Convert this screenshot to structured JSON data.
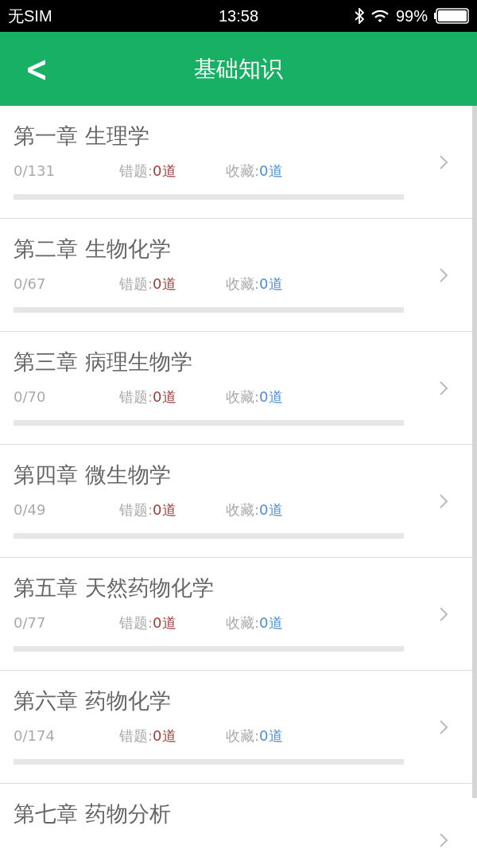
{
  "status_bar": {
    "carrier": "无SIM",
    "time": "13:58",
    "battery": "99%"
  },
  "header": {
    "back": "<",
    "title": "基础知识"
  },
  "chapters": [
    {
      "title": "第一章 生理学",
      "count": "0/131",
      "wrong_label": "错题:",
      "wrong_value": "0道",
      "fav_label": "收藏:",
      "fav_value": "0道",
      "level": 0
    },
    {
      "title": "第二章 生物化学",
      "count": "0/67",
      "wrong_label": "错题:",
      "wrong_value": "0道",
      "fav_label": "收藏:",
      "fav_value": "0道",
      "level": 0
    },
    {
      "title": "第三章 病理生物学",
      "count": "0/70",
      "wrong_label": "错题:",
      "wrong_value": "0道",
      "fav_label": "收藏:",
      "fav_value": "0道",
      "level": 0
    },
    {
      "title": "第四章 微生物学",
      "count": "0/49",
      "wrong_label": "错题:",
      "wrong_value": "0道",
      "fav_label": "收藏:",
      "fav_value": "0道",
      "level": 0
    },
    {
      "title": "第五章 天然药物化学",
      "count": "0/77",
      "wrong_label": "错题:",
      "wrong_value": "0道",
      "fav_label": "收藏:",
      "fav_value": "0道",
      "level": 0
    },
    {
      "title": "第六章 药物化学",
      "count": "0/174",
      "wrong_label": "错题:",
      "wrong_value": "0道",
      "fav_label": "收藏:",
      "fav_value": "0道",
      "level": 0
    },
    {
      "title": "第七章 药物分析"
    }
  ]
}
